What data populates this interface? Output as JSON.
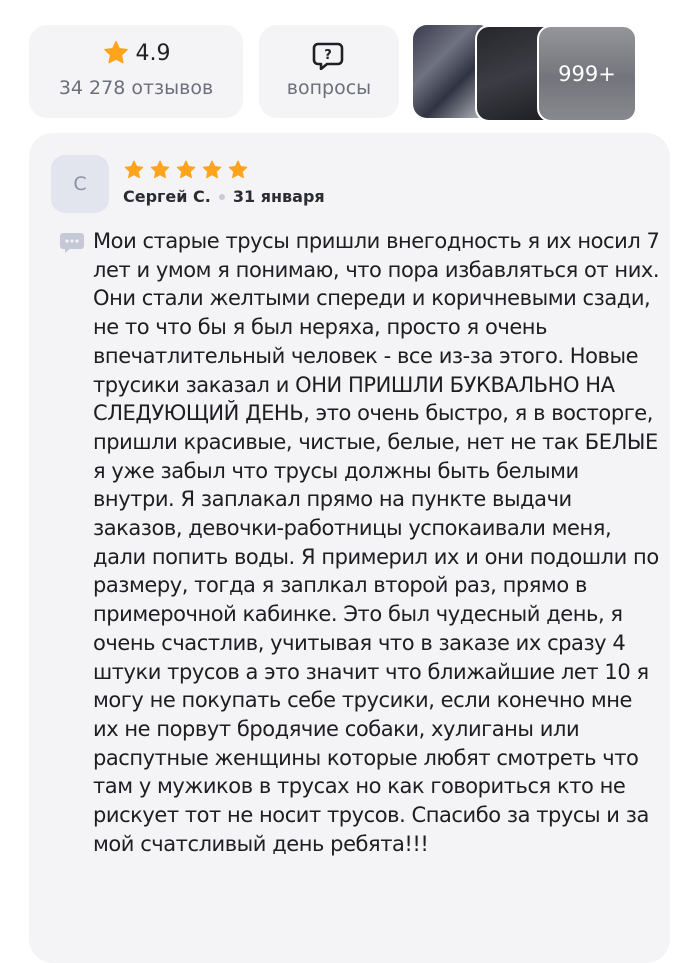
{
  "summary": {
    "rating": "4.9",
    "reviews_count": "34 278 отзывов",
    "questions_label": "вопросы",
    "photos_more": "999+"
  },
  "review": {
    "avatar_letter": "С",
    "stars": 5,
    "author": "Сергей С.",
    "date": "31 января",
    "text": "Мои старые трусы пришли внегодность я их носил 7 лет и умом я понимаю, что пора избавляться от них. Они стали желтыми спереди и коричневыми сзади, не то что бы я был неряха, просто я очень впечатлительный человек - все из-за этого. Новые трусики заказал и ОНИ ПРИШЛИ БУКВАЛЬНО НА СЛЕДУЮЩИЙ ДЕНЬ, это очень быстро, я в восторге, пришли красивые, чистые, белые, нет не так БЕЛЫЕ я уже забыл что трусы должны быть белыми внутри. Я заплакал прямо на пункте выдачи заказов, девочки-работницы успокаивали меня, дали попить воды. Я примерил их и они подошли по размеру, тогда я заплкал второй раз, прямо в примерочной кабинке. Это был чудесный день, я очень счастлив, учитывая что в заказе их сразу 4 штуки трусов а это значит что ближайшие лет 10 я могу не покупать себе трусики, если конечно мне их не порвут бродячие собаки, хулиганы или распутные женщины которые любят смотреть что там у мужиков в трусах но как говориться кто не рискует тот не носит трусов. Спасибо за трусы и за мой счатсливый день ребята!!!"
  },
  "colors": {
    "star": "#ffa41c",
    "card_bg": "#f4f4f7",
    "muted_text": "#6c6f7a"
  },
  "icons": {
    "star": "star-icon",
    "question": "question-bubble-icon",
    "comment": "comment-icon"
  }
}
